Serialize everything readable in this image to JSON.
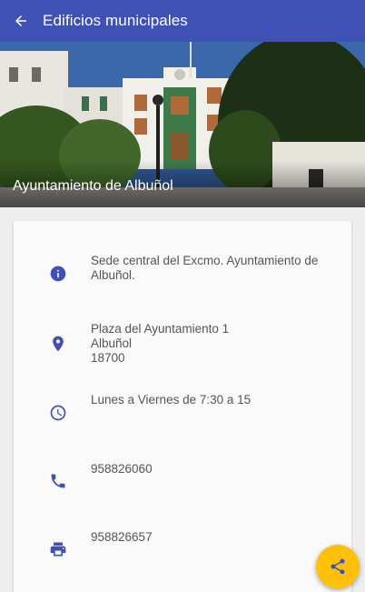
{
  "appbar": {
    "title": "Edificios municipales",
    "back_icon": "arrow-back-icon"
  },
  "hero": {
    "caption": "Ayuntamiento de Albuñol"
  },
  "details": {
    "description": "Sede central del Excmo. Ayuntamiento de Albuñol.",
    "address_line1": "Plaza del Ayuntamiento 1",
    "address_line2": "Albuñol",
    "address_line3": "18700",
    "hours": "Lunes a Viernes de 7:30 a 15",
    "phone": "958826060",
    "fax": "958826657"
  },
  "fab": {
    "icon": "share-icon"
  },
  "colors": {
    "primary": "#3f51b5",
    "accent": "#ffc107",
    "icon": "#3f51b5"
  }
}
